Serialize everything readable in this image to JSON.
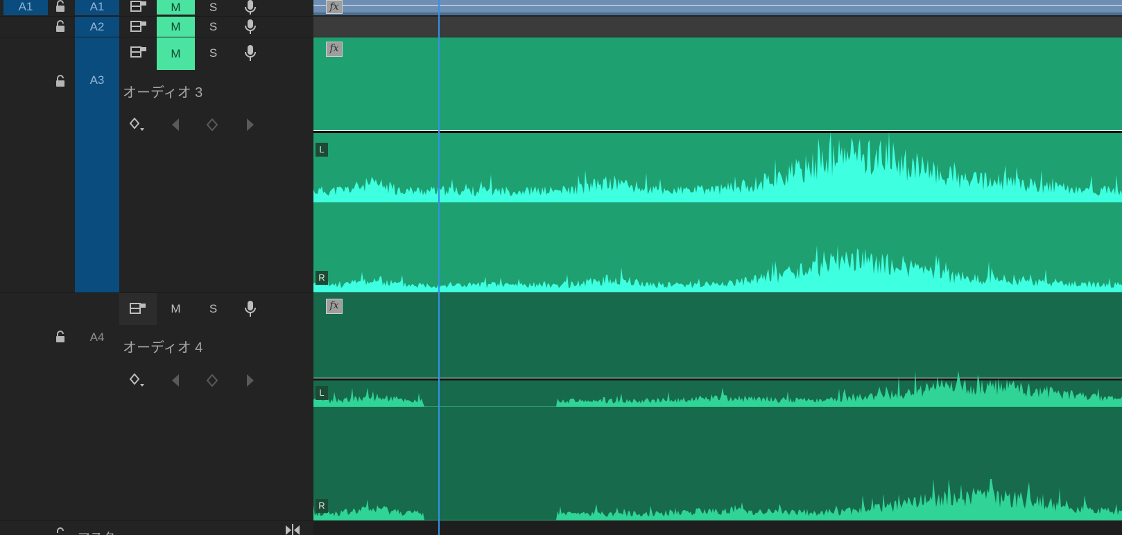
{
  "tracks": {
    "a1": {
      "source_label": "A1",
      "target_label": "A1",
      "mute_label": "M",
      "solo_label": "S"
    },
    "a2": {
      "target_label": "A2",
      "mute_label": "M",
      "solo_label": "S"
    },
    "a3": {
      "target_label": "A3",
      "mute_label": "M",
      "solo_label": "S",
      "name": "オーディオ 3"
    },
    "a4": {
      "target_label": "A4",
      "mute_label": "M",
      "solo_label": "S",
      "name": "オーディオ 4"
    },
    "master": {
      "name": "マスター"
    }
  },
  "clips": {
    "fx_label": "fx",
    "left_channel_label": "L",
    "right_channel_label": "R"
  },
  "colors": {
    "track_target_blue": "#0b4c7e",
    "mute_on_green": "#4be3a0",
    "clip_a3_bg": "#1fa070",
    "clip_a4_bg": "#176a4c",
    "waveform_a3": "#3effe0",
    "waveform_a4": "#2fd496",
    "playhead": "#3590e8",
    "clip_a1_bg": "#6e8fb3"
  }
}
